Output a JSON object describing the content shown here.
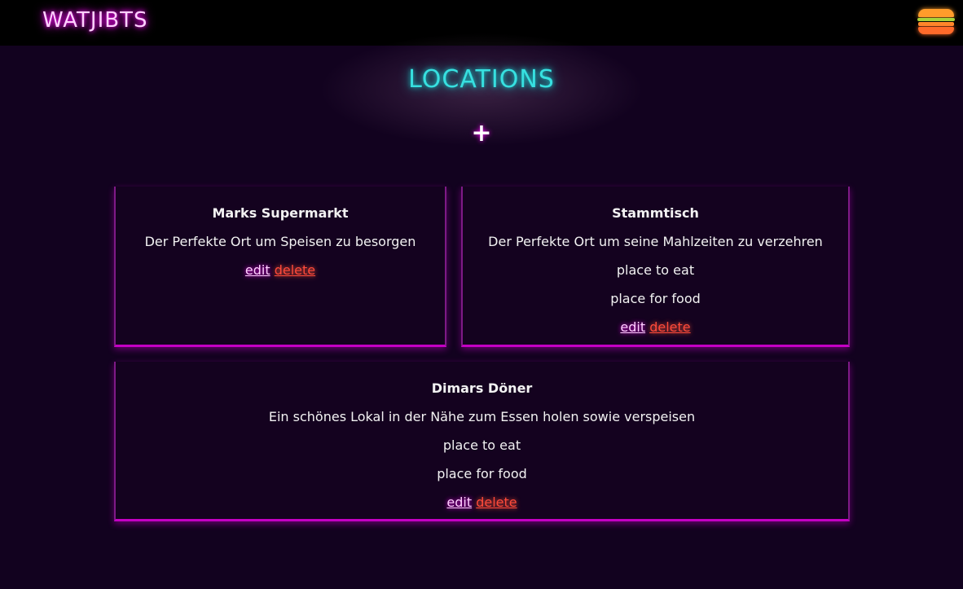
{
  "brand": "WATJIBTS",
  "page_title": "LOCATIONS",
  "add_label": "+",
  "colors": {
    "background": "#12021f",
    "header": "#000000",
    "title_neon": "#37e0e0",
    "brand_neon": "#ff00ff",
    "card_border": "#c400c4",
    "delete": "#ff4a3a"
  },
  "icons": {
    "menu": "hamburger-icon"
  },
  "locations": [
    {
      "name": "Marks Supermarkt",
      "description": "Der Perfekte Ort um Speisen zu besorgen",
      "tags": [],
      "edit": "edit",
      "delete": "delete"
    },
    {
      "name": "Stammtisch",
      "description": "Der Perfekte Ort um seine Mahlzeiten zu verzehren",
      "tags": [
        "place to eat",
        "place for food"
      ],
      "edit": "edit",
      "delete": "delete"
    },
    {
      "name": "Dimars Döner",
      "description": "Ein schönes Lokal in der Nähe zum Essen holen sowie verspeisen",
      "tags": [
        "place to eat",
        "place for food"
      ],
      "edit": "edit",
      "delete": "delete"
    }
  ]
}
